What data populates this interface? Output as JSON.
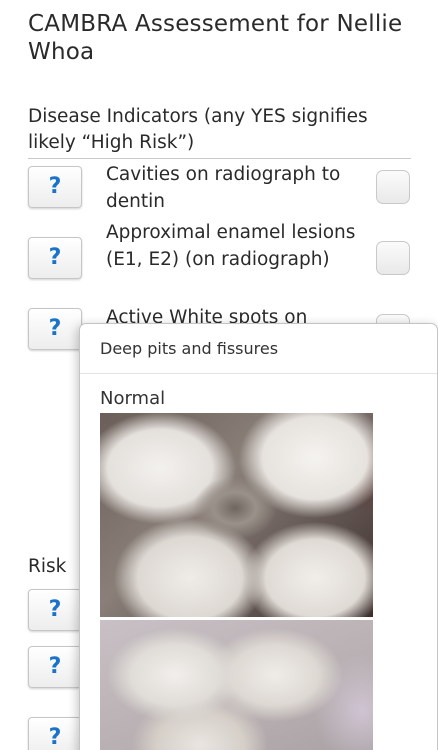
{
  "header": {
    "title": "CAMBRA Assessement for Nellie Whoa"
  },
  "disease_indicators": {
    "heading": "Disease Indicators (any YES signifies likely “High Risk”)",
    "help_label": "?",
    "items": [
      {
        "label": "Cavities on radiograph to dentin"
      },
      {
        "label": "Approximal enamel lesions (E1, E2) (on radiograph)"
      },
      {
        "label": "Active White spots on"
      }
    ]
  },
  "risk_section": {
    "heading": "Risk",
    "help_label": "?"
  },
  "popover": {
    "title": "Deep pits and fissures",
    "image_label": "Normal",
    "images": [
      {
        "icon": "tooth-photo-occlusal"
      },
      {
        "icon": "tooth-photo-occlusal"
      }
    ]
  }
}
